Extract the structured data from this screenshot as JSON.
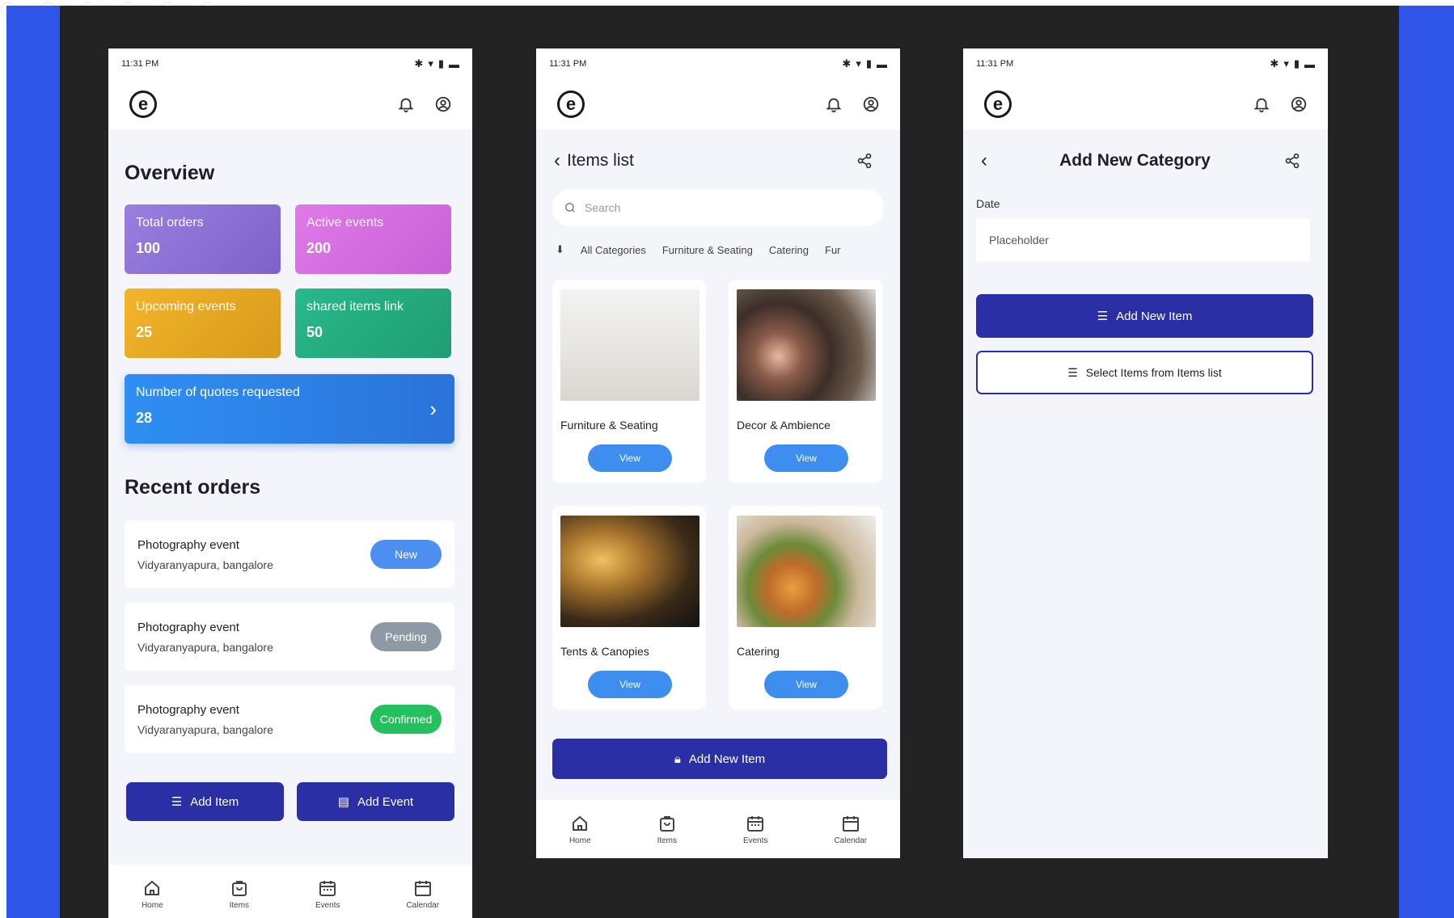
{
  "phone1": {
    "status": {
      "time": "11:31 PM",
      "icons": "✱ ▾ ∥ ▬"
    },
    "overview": {
      "title": "Overview",
      "stats": [
        {
          "label": "Total orders",
          "value": "100"
        },
        {
          "label": "Active events",
          "value": "200"
        },
        {
          "label": "Upcoming events",
          "value": "25"
        },
        {
          "label": "shared items link",
          "value": "50"
        }
      ],
      "quotes": {
        "label": "Number of quotes requested",
        "value": "28"
      }
    },
    "recent": {
      "title": "Recent orders",
      "orders": [
        {
          "title": "Photography event",
          "location": "Vidyaranyapura, bangalore",
          "status": "New"
        },
        {
          "title": "Photography event",
          "location": "Vidyaranyapura, bangalore",
          "status": "Pending"
        },
        {
          "title": "Photography event",
          "location": "Vidyaranyapura, bangalore",
          "status": "Confirmed"
        }
      ]
    },
    "buttons": {
      "add_item": "Add Item",
      "add_event": "Add Event"
    },
    "nav": [
      "Home",
      "Items",
      "Events",
      "Calendar"
    ]
  },
  "phone2": {
    "status": {
      "time": "11:31 PM"
    },
    "title": "Items list",
    "search_placeholder": "Search",
    "chips": [
      "All Categories",
      "Furniture & Seating",
      "Catering",
      "Fur"
    ],
    "cards": [
      {
        "name": "Furniture & Seating",
        "button": "View"
      },
      {
        "name": "Decor & Ambience",
        "button": "View"
      },
      {
        "name": "Tents & Canopies",
        "button": "View"
      },
      {
        "name": "Catering",
        "button": "View"
      }
    ],
    "add_button": "Add New Item",
    "nav": [
      "Home",
      "Items",
      "Events",
      "Calendar"
    ]
  },
  "phone3": {
    "status": {
      "time": "11:31 PM"
    },
    "title": "Add New Category",
    "field_label": "Date",
    "field_placeholder": "Placeholder",
    "add_button": "Add New Item",
    "select_button": "Select Items from Items list"
  }
}
